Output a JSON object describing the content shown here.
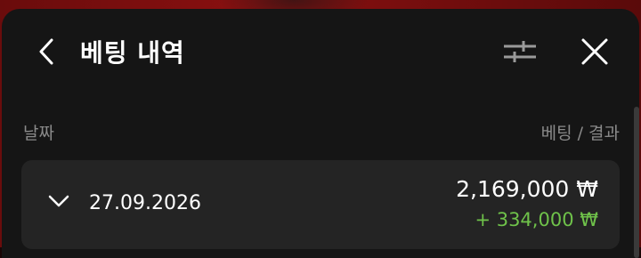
{
  "header": {
    "title": "베팅 내역",
    "back_icon": "chevron-left-icon",
    "filter_icon": "sliders-icon",
    "close_icon": "close-icon"
  },
  "columns": {
    "date": "날짜",
    "bet_result": "베팅 / 결과"
  },
  "rows": [
    {
      "expand_icon": "chevron-down-icon",
      "date": "27.09.2026",
      "bet_amount": "2,169,000 ₩",
      "result_amount": "+ 334,000 ₩"
    }
  ],
  "colors": {
    "background": "#151515",
    "card": "#242424",
    "muted_text": "#8a8a8a",
    "win": "#6fc24a",
    "backdrop": "#7a0e0e"
  }
}
